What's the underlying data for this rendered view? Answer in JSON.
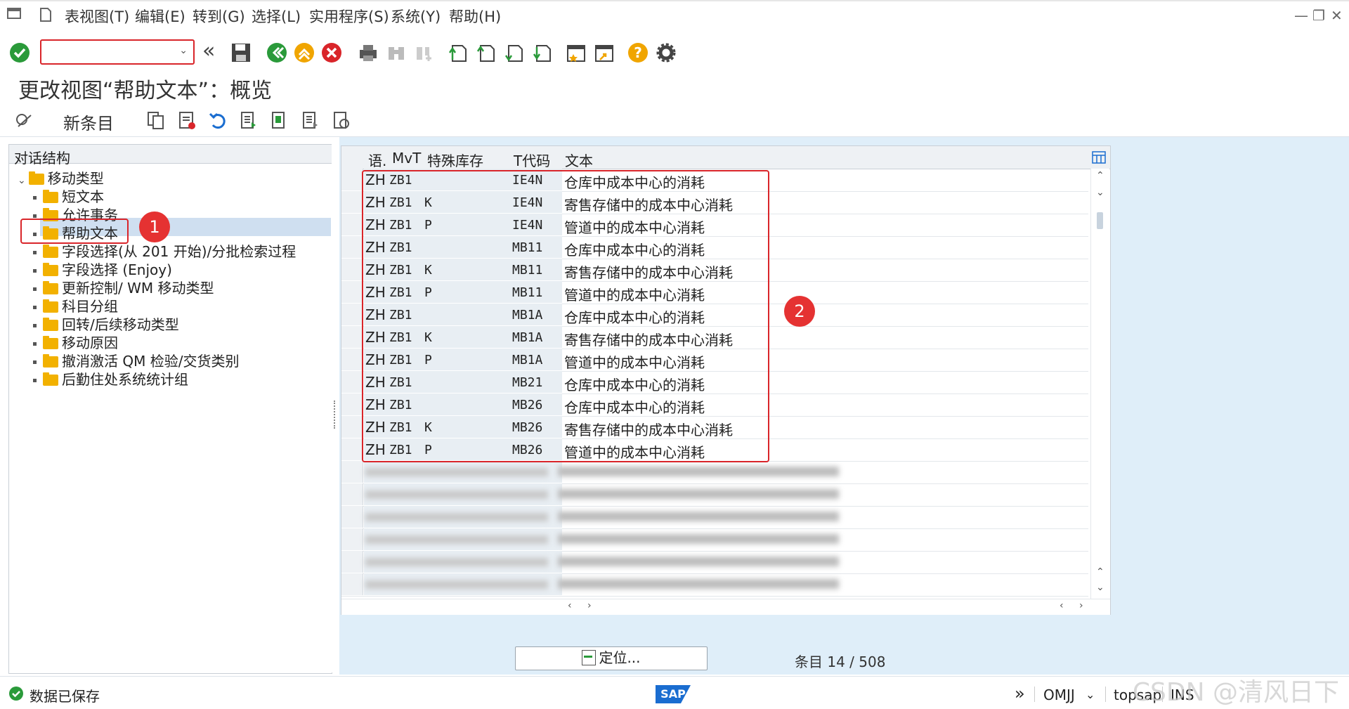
{
  "menu": {
    "items": [
      "表视图(T)",
      "编辑(E)",
      "转到(G)",
      "选择(L)",
      "实用程序(S)",
      "系统(Y)",
      "帮助(H)"
    ]
  },
  "command_field": {
    "value": ""
  },
  "page": {
    "title": "更改视图“帮助文本”：概览"
  },
  "app_toolbar": {
    "new_entry": "新条目"
  },
  "tree": {
    "header": "对话结构",
    "root": "移动类型",
    "items": [
      "短文本",
      "允许事务",
      "帮助文本",
      "字段选择(从 201 开始)/分批检索过程",
      "字段选择 (Enjoy)",
      "更新控制/ WM 移动类型",
      "科目分组",
      "回转/后续移动类型",
      "移动原因",
      "撤消激活 QM 检验/交货类别",
      "后勤住处系统统计组"
    ]
  },
  "grid": {
    "headers": [
      "语.",
      "MvT",
      "特殊库存",
      "T代码",
      "文本"
    ],
    "rows": [
      [
        "ZH",
        "ZB1",
        "",
        "IE4N",
        "仓库中成本中心的消耗"
      ],
      [
        "ZH",
        "ZB1",
        "K",
        "IE4N",
        "寄售存储中的成本中心消耗"
      ],
      [
        "ZH",
        "ZB1",
        "P",
        "IE4N",
        "管道中的成本中心消耗"
      ],
      [
        "ZH",
        "ZB1",
        "",
        "MB11",
        "仓库中成本中心的消耗"
      ],
      [
        "ZH",
        "ZB1",
        "K",
        "MB11",
        "寄售存储中的成本中心消耗"
      ],
      [
        "ZH",
        "ZB1",
        "P",
        "MB11",
        "管道中的成本中心消耗"
      ],
      [
        "ZH",
        "ZB1",
        "",
        "MB1A",
        "仓库中成本中心的消耗"
      ],
      [
        "ZH",
        "ZB1",
        "K",
        "MB1A",
        "寄售存储中的成本中心消耗"
      ],
      [
        "ZH",
        "ZB1",
        "P",
        "MB1A",
        "管道中的成本中心消耗"
      ],
      [
        "ZH",
        "ZB1",
        "",
        "MB21",
        "仓库中成本中心的消耗"
      ],
      [
        "ZH",
        "ZB1",
        "",
        "MB26",
        "仓库中成本中心的消耗"
      ],
      [
        "ZH",
        "ZB1",
        "K",
        "MB26",
        "寄售存储中的成本中心消耗"
      ],
      [
        "ZH",
        "ZB1",
        "P",
        "MB26",
        "管道中的成本中心消耗"
      ]
    ]
  },
  "callouts": {
    "one": "1",
    "two": "2"
  },
  "footer": {
    "locate_button": "定位...",
    "entry_label": "条目",
    "entry_count": "14 / 508"
  },
  "status": {
    "message": "数据已保存",
    "system": "OMJJ",
    "server": "topsap",
    "mode": "INS",
    "watermark": "CSDN @清风日下"
  }
}
